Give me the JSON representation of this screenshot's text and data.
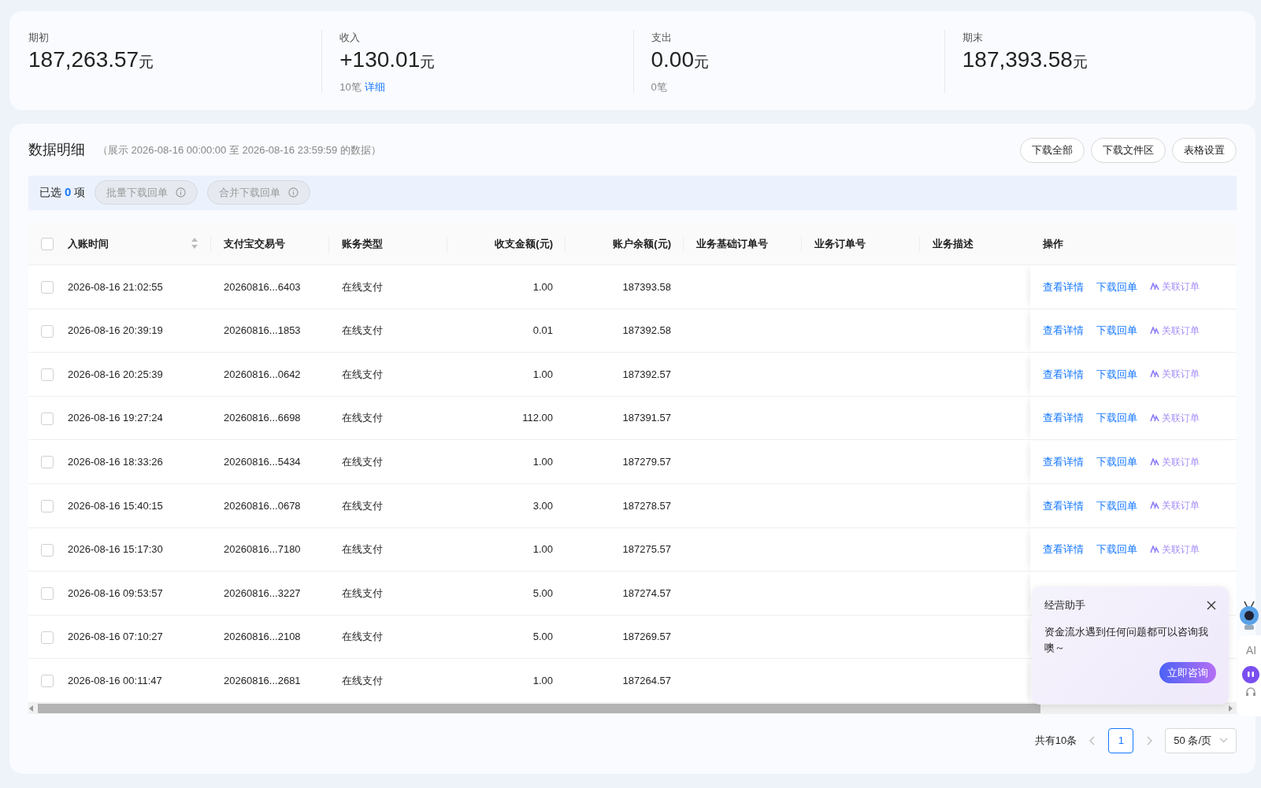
{
  "summary": [
    {
      "label": "期初",
      "amount": "187,263.57",
      "unit": "元"
    },
    {
      "label": "收入",
      "amount": "+130.01",
      "unit": "元",
      "count": "10笔",
      "link": "详细"
    },
    {
      "label": "支出",
      "amount": "0.00",
      "unit": "元",
      "count": "0笔"
    },
    {
      "label": "期末",
      "amount": "187,393.58",
      "unit": "元"
    }
  ],
  "detail": {
    "title": "数据明细",
    "range": "（展示 2026-08-16 00:00:00 至 2026-08-16 23:59:59 的数据）",
    "buttons": [
      "下载全部",
      "下载文件区",
      "表格设置"
    ]
  },
  "selection": {
    "prefix": "已选",
    "count": "0",
    "suffix": "项",
    "buttons": [
      {
        "label": "批量下载回单",
        "disabled": true
      },
      {
        "label": "合并下载回单",
        "disabled": true
      }
    ]
  },
  "table": {
    "all_checked": false,
    "columns": [
      {
        "label": "入账时间",
        "sortable": true
      },
      {
        "label": "支付宝交易号"
      },
      {
        "label": "账务类型"
      },
      {
        "label": "收支金额(元)"
      },
      {
        "label": "账户余额(元)"
      },
      {
        "label": "业务基础订单号"
      },
      {
        "label": "业务订单号"
      },
      {
        "label": "业务描述"
      },
      {
        "label": "操作"
      }
    ],
    "rows": [
      {
        "checked": false,
        "cells": [
          "2026-08-16 21:02:55",
          "20260816...6403",
          "在线支付",
          "1.00",
          "187393.58",
          "",
          "",
          ""
        ],
        "actions": [
          {
            "label": "查看详情",
            "kind": "link"
          },
          {
            "label": "下载回单",
            "kind": "link"
          },
          {
            "label": "关联订单",
            "kind": "ai"
          }
        ]
      },
      {
        "checked": false,
        "cells": [
          "2026-08-16 20:39:19",
          "20260816...1853",
          "在线支付",
          "0.01",
          "187392.58",
          "",
          "",
          ""
        ],
        "actions": [
          {
            "label": "查看详情",
            "kind": "link"
          },
          {
            "label": "下载回单",
            "kind": "link"
          },
          {
            "label": "关联订单",
            "kind": "ai"
          }
        ]
      },
      {
        "checked": false,
        "cells": [
          "2026-08-16 20:25:39",
          "20260816...0642",
          "在线支付",
          "1.00",
          "187392.57",
          "",
          "",
          ""
        ],
        "actions": [
          {
            "label": "查看详情",
            "kind": "link"
          },
          {
            "label": "下载回单",
            "kind": "link"
          },
          {
            "label": "关联订单",
            "kind": "ai"
          }
        ]
      },
      {
        "checked": false,
        "cells": [
          "2026-08-16 19:27:24",
          "20260816...6698",
          "在线支付",
          "112.00",
          "187391.57",
          "",
          "",
          ""
        ],
        "actions": [
          {
            "label": "查看详情",
            "kind": "link"
          },
          {
            "label": "下载回单",
            "kind": "link"
          },
          {
            "label": "关联订单",
            "kind": "ai"
          }
        ]
      },
      {
        "checked": false,
        "cells": [
          "2026-08-16 18:33:26",
          "20260816...5434",
          "在线支付",
          "1.00",
          "187279.57",
          "",
          "",
          ""
        ],
        "actions": [
          {
            "label": "查看详情",
            "kind": "link"
          },
          {
            "label": "下载回单",
            "kind": "link"
          },
          {
            "label": "关联订单",
            "kind": "ai"
          }
        ]
      },
      {
        "checked": false,
        "cells": [
          "2026-08-16 15:40:15",
          "20260816...0678",
          "在线支付",
          "3.00",
          "187278.57",
          "",
          "",
          ""
        ],
        "actions": [
          {
            "label": "查看详情",
            "kind": "link"
          },
          {
            "label": "下载回单",
            "kind": "link"
          },
          {
            "label": "关联订单",
            "kind": "ai"
          }
        ]
      },
      {
        "checked": false,
        "cells": [
          "2026-08-16 15:17:30",
          "20260816...7180",
          "在线支付",
          "1.00",
          "187275.57",
          "",
          "",
          ""
        ],
        "actions": [
          {
            "label": "查看详情",
            "kind": "link"
          },
          {
            "label": "下载回单",
            "kind": "link"
          },
          {
            "label": "关联订单",
            "kind": "ai"
          }
        ]
      },
      {
        "checked": false,
        "cells": [
          "2026-08-16 09:53:57",
          "20260816...3227",
          "在线支付",
          "5.00",
          "187274.57",
          "",
          "",
          ""
        ]
      },
      {
        "checked": false,
        "cells": [
          "2026-08-16 07:10:27",
          "20260816...2108",
          "在线支付",
          "5.00",
          "187269.57",
          "",
          "",
          ""
        ]
      },
      {
        "checked": false,
        "cells": [
          "2026-08-16 00:11:47",
          "20260816...2681",
          "在线支付",
          "1.00",
          "187264.57",
          "",
          "",
          ""
        ]
      }
    ]
  },
  "pagination": {
    "total": "共有10条",
    "pages": [
      {
        "label": "1",
        "selected": true
      }
    ],
    "page_size": "50 条/页"
  },
  "assistant": {
    "title": "经营助手",
    "message": "资金流水遇到任何问题都可以咨询我噢～",
    "button": "立即咨询"
  },
  "side_widget": {
    "label": "AI"
  }
}
